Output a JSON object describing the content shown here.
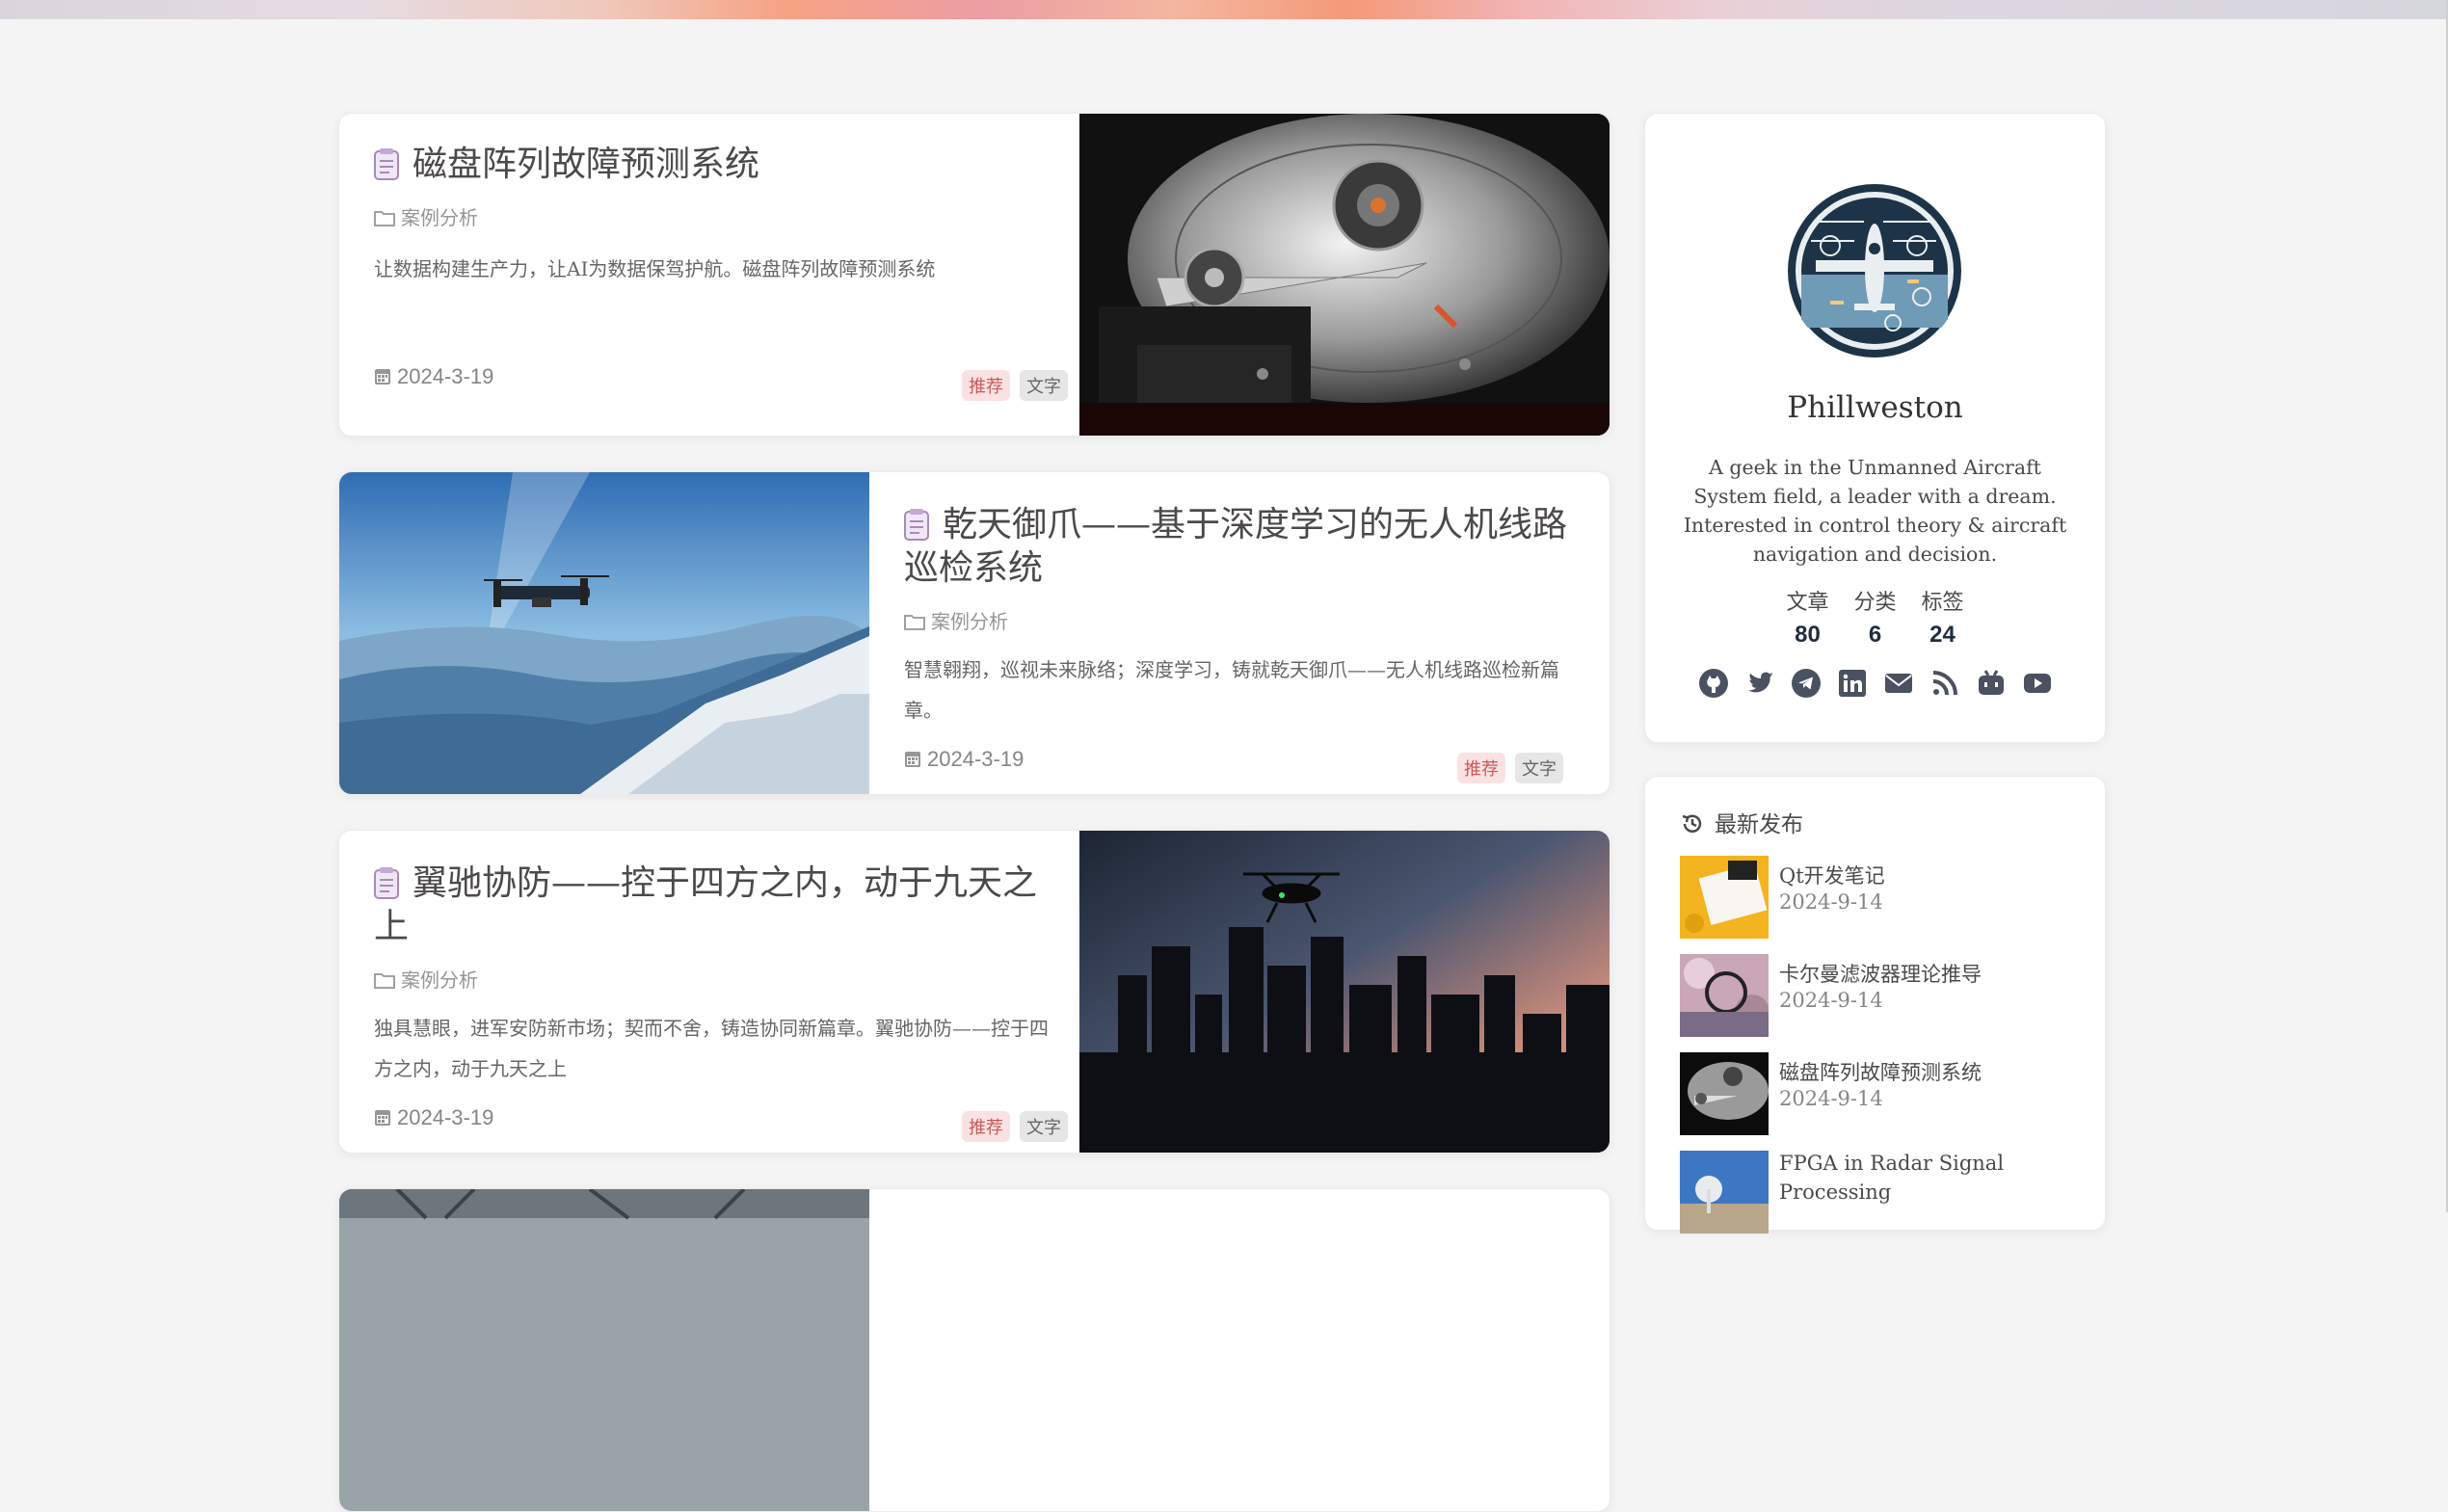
{
  "posts": [
    {
      "title": "磁盘阵列故障预测系统",
      "category": "案例分析",
      "excerpt": "让数据构建生产力，让AI为数据保驾护航。磁盘阵列故障预测系统",
      "date": "2024-3-19",
      "tags": [
        "推荐",
        "文字"
      ]
    },
    {
      "title": "乾天御爪——基于深度学习的无人机线路巡检系统",
      "category": "案例分析",
      "excerpt": "智慧翱翔，巡视未来脉络；深度学习，铸就乾天御爪——无人机线路巡检新篇章。",
      "date": "2024-3-19",
      "tags": [
        "推荐",
        "文字"
      ]
    },
    {
      "title": "翼驰协防——控于四方之内，动于九天之上",
      "category": "案例分析",
      "excerpt": "独具慧眼，进军安防新市场；契而不舍，铸造协同新篇章。翼驰协防——控于四方之内，动于九天之上",
      "date": "2024-3-19",
      "tags": [
        "推荐",
        "文字"
      ]
    }
  ],
  "author": {
    "name": "Phillweston",
    "description": "A geek in the Unmanned Aircraft System field, a leader with a dream. Interested in control theory & aircraft navigation and decision.",
    "stats": [
      {
        "label": "文章",
        "value": "80"
      },
      {
        "label": "分类",
        "value": "6"
      },
      {
        "label": "标签",
        "value": "24"
      }
    ],
    "socials": [
      "github-icon",
      "twitter-icon",
      "telegram-icon",
      "linkedin-icon",
      "email-icon",
      "rss-icon",
      "bilibili-icon",
      "youtube-icon"
    ]
  },
  "recent": {
    "heading": "最新发布",
    "items": [
      {
        "title": "Qt开发笔记",
        "date": "2024-9-14"
      },
      {
        "title": "卡尔曼滤波器理论推导",
        "date": "2024-9-14"
      },
      {
        "title": "磁盘阵列故障预测系统",
        "date": "2024-9-14"
      },
      {
        "title": "FPGA in Radar Signal Processing",
        "date": ""
      }
    ]
  },
  "colors": {
    "page_bg": "#f4f4f4",
    "tag_recommend_bg": "#fbe2e2",
    "tag_text_bg": "#e6e6e6",
    "stat_value": "#1f2d3d"
  }
}
